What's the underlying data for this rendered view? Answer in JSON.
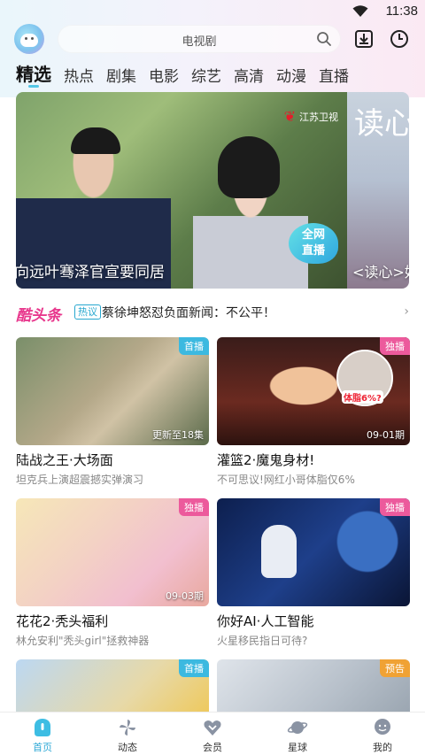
{
  "status_bar": {
    "time": "11:38"
  },
  "header": {
    "search_placeholder": "电视剧"
  },
  "tabs": [
    {
      "label": "精选",
      "active": true
    },
    {
      "label": "热点"
    },
    {
      "label": "剧集"
    },
    {
      "label": "电影"
    },
    {
      "label": "综艺"
    },
    {
      "label": "高清"
    },
    {
      "label": "动漫"
    },
    {
      "label": "直播"
    }
  ],
  "banner": {
    "main_caption": "向远叶骞泽官宣要同居",
    "channel": "江苏卫视",
    "live_badge_line1": "全网",
    "live_badge_line2": "直播",
    "next_title": "读心",
    "next_caption": "<读心>好"
  },
  "ticker": {
    "brand": "酷头条",
    "tag": "热议",
    "headline": "蔡徐坤怒怼负面新闻：不公平！"
  },
  "cards": [
    {
      "title": "陆战之王·大场面",
      "subtitle": "坦克兵上演超震撼实弹演习",
      "badge": "首播",
      "overlay": "更新至18集",
      "badge_color": "#3cb9e0"
    },
    {
      "title": "灌篮2·魔鬼身材!",
      "subtitle": "不可思议!网红小哥体脂仅6%",
      "badge": "独播",
      "overlay": "09-01期",
      "badge_color": "#ec5a9c",
      "inset_text": "体脂6%?"
    },
    {
      "title": "花花2·秃头福利",
      "subtitle": "林允安利\"秃头girl\"拯救神器",
      "badge": "独播",
      "overlay": "09-03期",
      "badge_color": "#ec5a9c"
    },
    {
      "title": "你好AI·人工智能",
      "subtitle": "火星移民指日可待?",
      "badge": "独播",
      "overlay": "",
      "badge_color": "#ec5a9c"
    },
    {
      "title": "",
      "subtitle": "",
      "badge": "首播",
      "overlay": "",
      "badge_color": "#3cb9e0"
    },
    {
      "title": "",
      "subtitle": "",
      "badge": "预告",
      "overlay": "",
      "badge_color": "#f0a234"
    }
  ],
  "bottom_nav": [
    {
      "label": "首页",
      "icon": "home-icon",
      "active": true
    },
    {
      "label": "动态",
      "icon": "pinwheel-icon"
    },
    {
      "label": "会员",
      "icon": "vip-heart-icon"
    },
    {
      "label": "星球",
      "icon": "planet-icon"
    },
    {
      "label": "我的",
      "icon": "profile-icon"
    }
  ],
  "colors": {
    "accent": "#2fa9d6",
    "brand_pink": "#e8388d",
    "badge_blue": "#3cb9e0",
    "badge_pink": "#ec5a9c",
    "badge_orange": "#f0a234"
  }
}
